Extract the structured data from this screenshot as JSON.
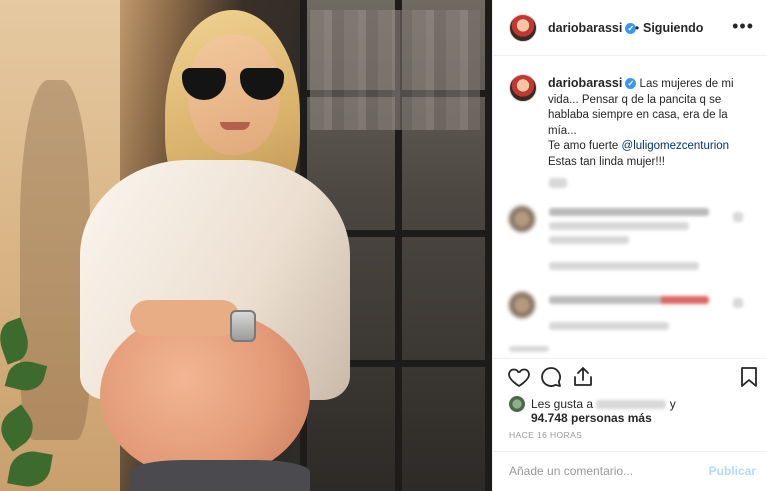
{
  "post": {
    "username": "dariobarassi",
    "verified_icon": "verified-badge-icon",
    "separator": "•",
    "follow_status": "Siguiendo",
    "more_icon": "more-options-icon"
  },
  "caption": {
    "username": "dariobarassi",
    "text_part1": "Las mujeres de mi vida... Pensar q de la pancita q se hablaba siempre en casa, era de la mía...",
    "text_part2": "Te amo fuerte ",
    "mention": "@luligomezcenturion",
    "text_part3": "Estas tan linda mujer!!!"
  },
  "actions": {
    "like_icon": "heart-icon",
    "comment_icon": "comment-icon",
    "share_icon": "share-icon",
    "save_icon": "bookmark-icon"
  },
  "likes": {
    "prefix": "Les gusta a",
    "connector": "y",
    "count": "94.748 personas más"
  },
  "timestamp": "HACE 16 HORAS",
  "comment": {
    "placeholder": "Añade un comentario...",
    "publish_label": "Publicar"
  },
  "colors": {
    "link": "#003569",
    "verified": "#3897f0",
    "publish_disabled": "#b3dbff"
  }
}
